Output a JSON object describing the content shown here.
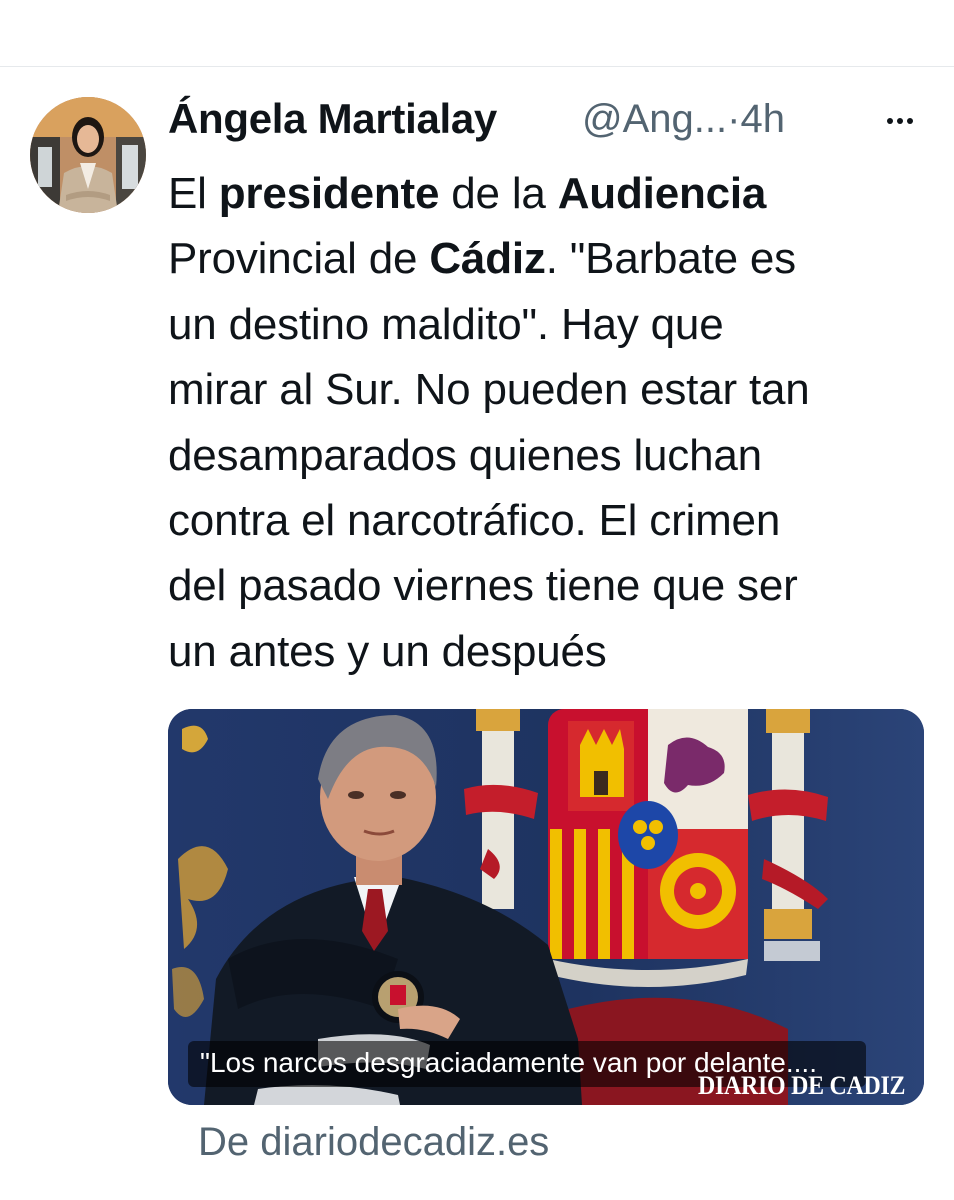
{
  "tweet": {
    "author": {
      "name": "Ángela Martialay",
      "handle": "@Ang...",
      "separator": "·",
      "time": "4h"
    },
    "text_lines": [
      [
        {
          "t": "El ",
          "b": false
        },
        {
          "t": "presidente",
          "b": true
        },
        {
          "t": " de la ",
          "b": false
        },
        {
          "t": "Audiencia",
          "b": true
        }
      ],
      [
        {
          "t": "Provincial de ",
          "b": false
        },
        {
          "t": "Cádiz",
          "b": true
        },
        {
          "t": ". \"Barbate es",
          "b": false
        }
      ],
      [
        {
          "t": "un destino maldito\". Hay que",
          "b": false
        }
      ],
      [
        {
          "t": "mirar al Sur. No pueden estar tan",
          "b": false
        }
      ],
      [
        {
          "t": "desamparados quienes luchan",
          "b": false
        }
      ],
      [
        {
          "t": "contra el narcotráfico. El crimen",
          "b": false
        }
      ],
      [
        {
          "t": "del pasado viernes tiene que ser",
          "b": false
        }
      ],
      [
        {
          "t": "un antes y un después",
          "b": false
        }
      ]
    ],
    "card": {
      "caption": "\"Los narcos desgraciadamente van por delante....",
      "watermark": "DIARIO DE CADIZ"
    },
    "source": "De diariodecadiz.es"
  },
  "colors": {
    "text": "#0f1419",
    "secondary": "#536471",
    "divider": "#e6e9ec",
    "flag_red": "#c8102e",
    "flag_yellow": "#f1bf00",
    "background_blue": "#1f3564"
  },
  "icons": [
    "more-options-icon"
  ]
}
